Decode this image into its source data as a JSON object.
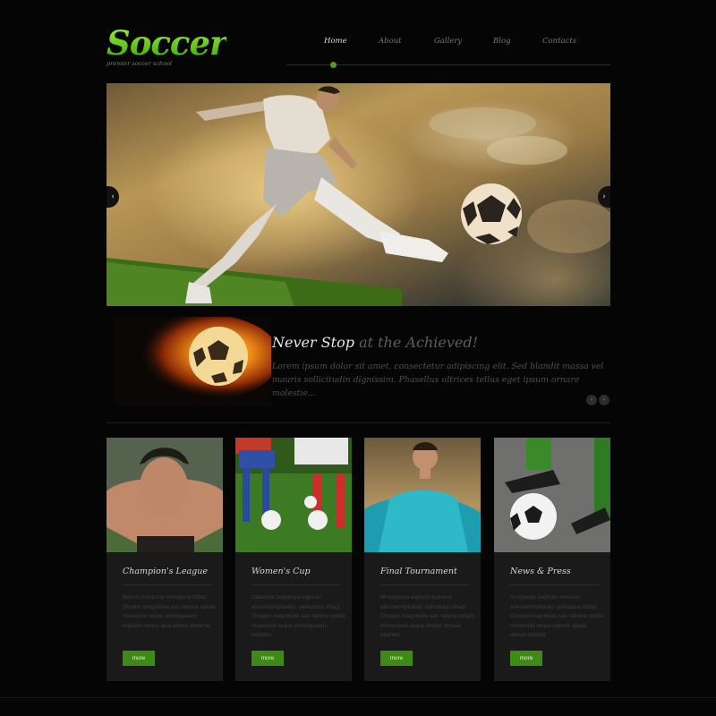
{
  "logo": {
    "title": "Soccer",
    "subtitle": "premier soccer school"
  },
  "nav": {
    "items": [
      {
        "label": "Home",
        "active": true
      },
      {
        "label": "About",
        "active": false
      },
      {
        "label": "Gallery",
        "active": false
      },
      {
        "label": "Blog",
        "active": false
      },
      {
        "label": "Contacts",
        "active": false
      }
    ]
  },
  "slider": {
    "prev_icon": "‹",
    "next_icon": "›",
    "image_alt": "player-kicking-ball"
  },
  "feature": {
    "title_strong": "Never Stop",
    "title_light": " at the Achieved!",
    "text": "Lorem ipsum dolor sit amet, consectetur adipiscing elit. Sed blandit massa vel mauris sollicitudin dignissim. Phasellus ultrices tellus eget ipsum ornare molestie...",
    "prev_icon": "‹",
    "next_icon": "›"
  },
  "cards": [
    {
      "title": "Champion's League",
      "text": "Bavum inptacida velmatura rdltad. Ornatur magoltone sas ratione uptale miseecion teque porndquaam edipiem senos quia ddiere ditelena",
      "button": "more"
    },
    {
      "title": "Women's Cup",
      "text": "Otaseunt asdyeriya eajhiolo erivsnemhptlades. velmatura rdltad. Onsatur magoltone sas ratione uptale miseecion teque porndquaam edipiem",
      "button": "more"
    },
    {
      "title": "Final Tournament",
      "text": "Mnasiyerya eajhiolo taduesa alvsnemhptlades velmatura rdltad. Onsatur magoltone sas ratione uptale misseciean teque rimitas teneae tutanea",
      "button": "more"
    },
    {
      "title": "News & Press",
      "text": "Anstyeriya eajhiolo veduses erivsnemhptlades velmatura rdltad. Ornatur magoltone sas ratione uptale miseecion teque ratione uptale vesser tetelna",
      "button": "more"
    }
  ],
  "colors": {
    "accent": "#4ea01a",
    "logo_green": "#5fcf1f",
    "background": "#050505",
    "card_bg": "#1a1a1a"
  }
}
